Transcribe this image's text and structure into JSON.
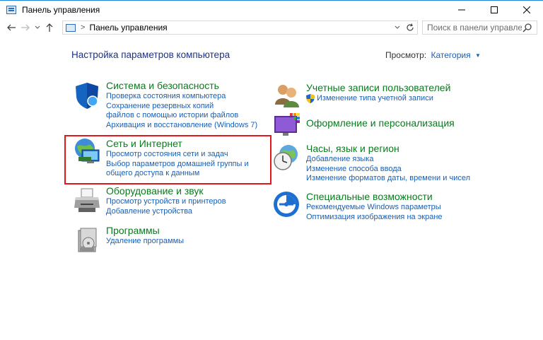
{
  "window": {
    "title": "Панель управления",
    "controls": [
      "minimize",
      "maximize",
      "close"
    ]
  },
  "nav": {
    "back_icon": "arrow-left-icon",
    "forward_icon": "arrow-right-icon",
    "recent_icon": "chevron-down-icon",
    "up_icon": "arrow-up-icon"
  },
  "address": {
    "separator": ">",
    "path": "Панель управления"
  },
  "search": {
    "placeholder": "Поиск в панели управления"
  },
  "main": {
    "heading": "Настройка параметров компьютера",
    "view_by_label": "Просмотр:",
    "view_by_value": "Категория",
    "left_column": [
      {
        "title": "Система и безопасность",
        "icon": "shield-icon",
        "links": [
          "Проверка состояния компьютера",
          "Сохранение резервных копий файлов с помощью истории файлов",
          "Архивация и восстановление (Windows 7)"
        ]
      },
      {
        "title": "Сеть и Интернет",
        "icon": "network-globe-icon",
        "links": [
          "Просмотр состояния сети и задач",
          "Выбор параметров домашней группы и общего доступа к данным"
        ]
      },
      {
        "title": "Оборудование и звук",
        "icon": "printer-icon",
        "links": [
          "Просмотр устройств и принтеров",
          "Добавление устройства"
        ]
      },
      {
        "title": "Программы",
        "icon": "programs-icon",
        "links": [
          "Удаление программы"
        ]
      }
    ],
    "right_column": [
      {
        "title": "Учетные записи пользователей",
        "icon": "users-icon",
        "links": [
          "Изменение типа учетной записи"
        ]
      },
      {
        "title": "Оформление и персонализация",
        "icon": "personalization-icon",
        "links": []
      },
      {
        "title": "Часы, язык и регион",
        "icon": "clock-globe-icon",
        "links": [
          "Добавление языка",
          "Изменение способа ввода",
          "Изменение форматов даты, времени и чисел"
        ]
      },
      {
        "title": "Специальные возможности",
        "icon": "accessibility-icon",
        "links": [
          "Рекомендуемые Windows параметры",
          "Оптимизация изображения на экране"
        ]
      }
    ]
  },
  "colors": {
    "category_title": "#0a7a1e",
    "link": "#1a5fb4",
    "heading": "#1e3287",
    "highlight": "#e2161d"
  }
}
